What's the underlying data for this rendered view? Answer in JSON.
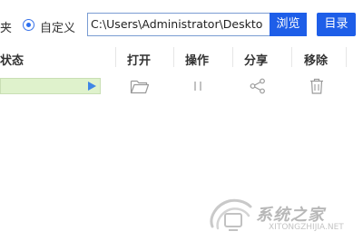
{
  "options": {
    "folder_label": "夹",
    "custom_label": "自定义",
    "custom_selected": true
  },
  "path": {
    "value": "C:\\Users\\Administrator\\Deskto"
  },
  "buttons": {
    "browse": "浏览",
    "directory": "目录"
  },
  "table": {
    "columns": {
      "status": "状态",
      "open": "打开",
      "operate": "操作",
      "share": "分享",
      "remove": "移除"
    }
  },
  "task_row": {
    "progress_fraction": 1.0,
    "icons": {
      "open": "folder-icon",
      "operate": "pause-icon",
      "share": "share-icon",
      "remove": "trash-icon",
      "start": "play-icon"
    }
  },
  "watermark": {
    "text": "系统之家",
    "url": "XITONGZHIJIA.NET"
  },
  "colors": {
    "accent": "#1e5ee8",
    "progress": "#e8f6d9",
    "icon": "#9a9a9a"
  }
}
